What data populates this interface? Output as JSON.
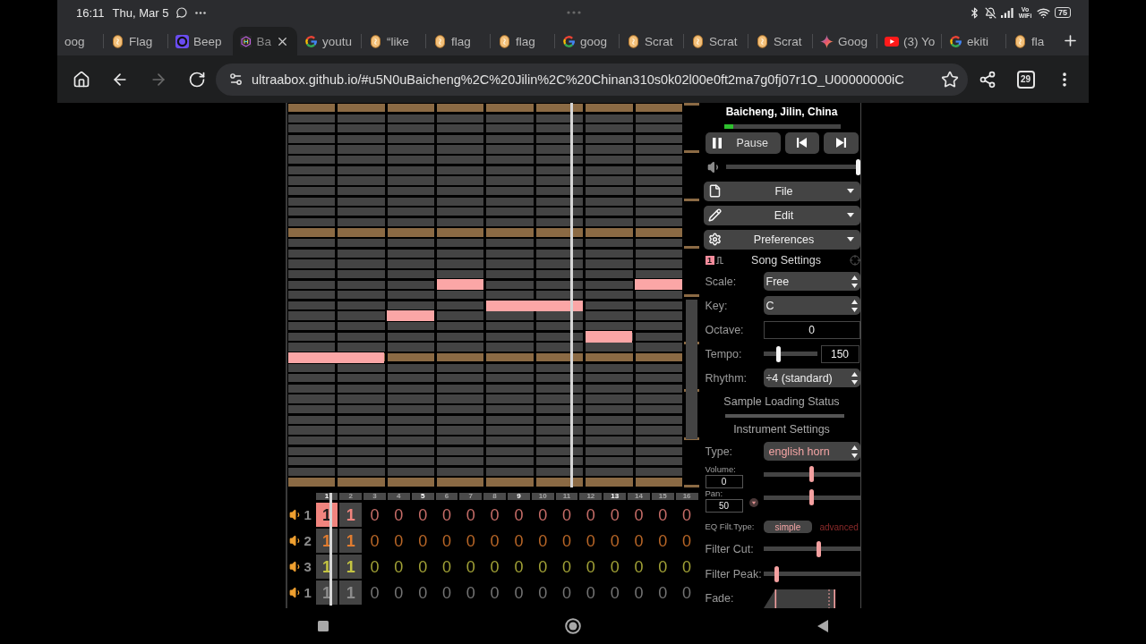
{
  "status_bar": {
    "time": "16:11",
    "date": "Thu, Mar 5",
    "network_label": "Vo WiFi",
    "battery": "75"
  },
  "tabs": [
    {
      "label": "oog",
      "selected": false
    },
    {
      "kind": "oval",
      "label": "Flag",
      "selected": false
    },
    {
      "kind": "ring",
      "label": "Beep",
      "selected": false
    },
    {
      "kind": "hexagon",
      "label": "Ba",
      "selected": true
    },
    {
      "kind": "g",
      "label": "youtu",
      "selected": false
    },
    {
      "kind": "oval",
      "label": "“like",
      "selected": false
    },
    {
      "kind": "oval",
      "label": "flag",
      "selected": false
    },
    {
      "kind": "oval",
      "label": "flag",
      "selected": false
    },
    {
      "kind": "g",
      "label": "goog",
      "selected": false
    },
    {
      "kind": "oval",
      "label": "Scrat",
      "selected": false
    },
    {
      "kind": "oval",
      "label": "Scrat",
      "selected": false
    },
    {
      "kind": "oval",
      "label": "Scrat",
      "selected": false
    },
    {
      "kind": "sparkle",
      "label": "Goog",
      "selected": false
    },
    {
      "kind": "play",
      "label": "(3) Yo",
      "selected": false
    },
    {
      "kind": "g",
      "label": "ekiti",
      "selected": false
    },
    {
      "kind": "oval",
      "label": "fla",
      "selected": false
    }
  ],
  "toolbar": {
    "buttons": [
      {
        "kind": "home",
        "disabled": false
      },
      {
        "kind": "back",
        "disabled": false
      },
      {
        "kind": "forward",
        "disabled": true
      },
      {
        "kind": "reload",
        "disabled": false
      }
    ],
    "url": "ultraabox.github.io/#u5N0uBaicheng%2C%20Jilin%2C%20Chinan310s0k02l00e0ft2ma7g0fj07r1O_U00000000iC",
    "tab_count": "29"
  },
  "pattern_editor": {
    "bars": [
      {
        "label": "1",
        "emphasized": true
      },
      {
        "label": "2",
        "emphasized": false
      },
      {
        "label": "3",
        "emphasized": false
      },
      {
        "label": "4",
        "emphasized": false
      },
      {
        "label": "5",
        "emphasized": true
      },
      {
        "label": "6",
        "emphasized": false
      },
      {
        "label": "7",
        "emphasized": false
      },
      {
        "label": "8",
        "emphasized": false
      },
      {
        "label": "9",
        "emphasized": true
      },
      {
        "label": "10",
        "emphasized": false
      },
      {
        "label": "11",
        "emphasized": false
      },
      {
        "label": "12",
        "emphasized": false
      },
      {
        "label": "13",
        "emphasized": true
      },
      {
        "label": "14",
        "emphasized": false
      },
      {
        "label": "15",
        "emphasized": false
      },
      {
        "label": "16",
        "emphasized": false
      }
    ],
    "tracks": [
      {
        "label": "1",
        "color": "#f0847e",
        "cells": [
          {
            "value": "1",
            "kind": "pattern",
            "selected": true
          },
          {
            "value": "1",
            "kind": "pattern",
            "selected": false
          },
          {
            "value": "0",
            "kind": "empty",
            "selected": false
          },
          {
            "value": "0",
            "kind": "empty",
            "selected": false
          },
          {
            "value": "0",
            "kind": "empty",
            "selected": false
          },
          {
            "value": "0",
            "kind": "empty",
            "selected": false
          },
          {
            "value": "0",
            "kind": "empty",
            "selected": false
          },
          {
            "value": "0",
            "kind": "empty",
            "selected": false
          },
          {
            "value": "0",
            "kind": "empty",
            "selected": false
          },
          {
            "value": "0",
            "kind": "empty",
            "selected": false
          },
          {
            "value": "0",
            "kind": "empty",
            "selected": false
          },
          {
            "value": "0",
            "kind": "empty",
            "selected": false
          },
          {
            "value": "0",
            "kind": "empty",
            "selected": false
          },
          {
            "value": "0",
            "kind": "empty",
            "selected": false
          },
          {
            "value": "0",
            "kind": "empty",
            "selected": false
          },
          {
            "value": "0",
            "kind": "empty",
            "selected": false
          }
        ]
      },
      {
        "label": "2",
        "color": "#e07c30",
        "cells": [
          {
            "value": "1",
            "kind": "pattern",
            "selected": false
          },
          {
            "value": "1",
            "kind": "pattern",
            "selected": false
          },
          {
            "value": "0",
            "kind": "empty",
            "selected": false
          },
          {
            "value": "0",
            "kind": "empty",
            "selected": false
          },
          {
            "value": "0",
            "kind": "empty",
            "selected": false
          },
          {
            "value": "0",
            "kind": "empty",
            "selected": false
          },
          {
            "value": "0",
            "kind": "empty",
            "selected": false
          },
          {
            "value": "0",
            "kind": "empty",
            "selected": false
          },
          {
            "value": "0",
            "kind": "empty",
            "selected": false
          },
          {
            "value": "0",
            "kind": "empty",
            "selected": false
          },
          {
            "value": "0",
            "kind": "empty",
            "selected": false
          },
          {
            "value": "0",
            "kind": "empty",
            "selected": false
          },
          {
            "value": "0",
            "kind": "empty",
            "selected": false
          },
          {
            "value": "0",
            "kind": "empty",
            "selected": false
          },
          {
            "value": "0",
            "kind": "empty",
            "selected": false
          },
          {
            "value": "0",
            "kind": "empty",
            "selected": false
          }
        ]
      },
      {
        "label": "3",
        "color": "#c4c442",
        "cells": [
          {
            "value": "1",
            "kind": "pattern",
            "selected": false
          },
          {
            "value": "1",
            "kind": "pattern",
            "selected": false
          },
          {
            "value": "0",
            "kind": "empty",
            "selected": false
          },
          {
            "value": "0",
            "kind": "empty",
            "selected": false
          },
          {
            "value": "0",
            "kind": "empty",
            "selected": false
          },
          {
            "value": "0",
            "kind": "empty",
            "selected": false
          },
          {
            "value": "0",
            "kind": "empty",
            "selected": false
          },
          {
            "value": "0",
            "kind": "empty",
            "selected": false
          },
          {
            "value": "0",
            "kind": "empty",
            "selected": false
          },
          {
            "value": "0",
            "kind": "empty",
            "selected": false
          },
          {
            "value": "0",
            "kind": "empty",
            "selected": false
          },
          {
            "value": "0",
            "kind": "empty",
            "selected": false
          },
          {
            "value": "0",
            "kind": "empty",
            "selected": false
          },
          {
            "value": "0",
            "kind": "empty",
            "selected": false
          },
          {
            "value": "0",
            "kind": "empty",
            "selected": false
          },
          {
            "value": "0",
            "kind": "empty",
            "selected": false
          }
        ]
      },
      {
        "label": "1",
        "color": "#8c8c8c",
        "cells": [
          {
            "value": "1",
            "kind": "pattern",
            "selected": false
          },
          {
            "value": "1",
            "kind": "pattern",
            "selected": false
          },
          {
            "value": "0",
            "kind": "empty",
            "selected": false
          },
          {
            "value": "0",
            "kind": "empty",
            "selected": false
          },
          {
            "value": "0",
            "kind": "empty",
            "selected": false
          },
          {
            "value": "0",
            "kind": "empty",
            "selected": false
          },
          {
            "value": "0",
            "kind": "empty",
            "selected": false
          },
          {
            "value": "0",
            "kind": "empty",
            "selected": false
          },
          {
            "value": "0",
            "kind": "empty",
            "selected": false
          },
          {
            "value": "0",
            "kind": "empty",
            "selected": false
          },
          {
            "value": "0",
            "kind": "empty",
            "selected": false
          },
          {
            "value": "0",
            "kind": "empty",
            "selected": false
          },
          {
            "value": "0",
            "kind": "empty",
            "selected": false
          },
          {
            "value": "0",
            "kind": "empty",
            "selected": false
          },
          {
            "value": "0",
            "kind": "empty",
            "selected": false
          },
          {
            "value": "0",
            "kind": "empty",
            "selected": false
          }
        ]
      }
    ]
  },
  "player": {
    "song_title": "Baicheng, Jilin, China",
    "progress": {
      "level": 0.08
    },
    "pause_label": "Pause",
    "volume": {
      "level": 1
    }
  },
  "menus": [
    {
      "kind": "file",
      "label": "File"
    },
    {
      "kind": "edit",
      "label": "Edit"
    },
    {
      "kind": "preferences",
      "label": "Preferences"
    }
  ],
  "song_settings": {
    "channel_badge": "1",
    "title": "Song Settings",
    "rows": [
      {
        "kind": "select",
        "label": "Scale:",
        "value": "Free"
      },
      {
        "kind": "select",
        "label": "Key:",
        "value": "C"
      },
      {
        "kind": "number",
        "label": "Octave:",
        "value": "0"
      },
      {
        "kind": "slider",
        "label": "Tempo:",
        "level": 0.27,
        "value": "150"
      },
      {
        "kind": "select",
        "label": "Rhythm:",
        "value": "÷4 (standard)"
      }
    ]
  },
  "sample_loading": {
    "title": "Sample Loading Status"
  },
  "instrument_settings": {
    "title": "Instrument Settings",
    "type": {
      "label": "Type:",
      "value": "english horn"
    },
    "volume": {
      "label": "Volume:",
      "value": "0",
      "level": 0.5
    },
    "pan": {
      "label": "Pan:",
      "value": "50",
      "level": 0.5
    },
    "eq": {
      "label": "EQ Filt.Type:",
      "options": [
        {
          "label": "simple",
          "selected": true
        },
        {
          "label": "advanced",
          "selected": false
        }
      ]
    },
    "sliders": [
      {
        "label": "Filter Cut:",
        "level": 0.58
      },
      {
        "label": "Filter Peak:",
        "level": 0.12
      }
    ],
    "fade": {
      "label": "Fade:"
    }
  }
}
